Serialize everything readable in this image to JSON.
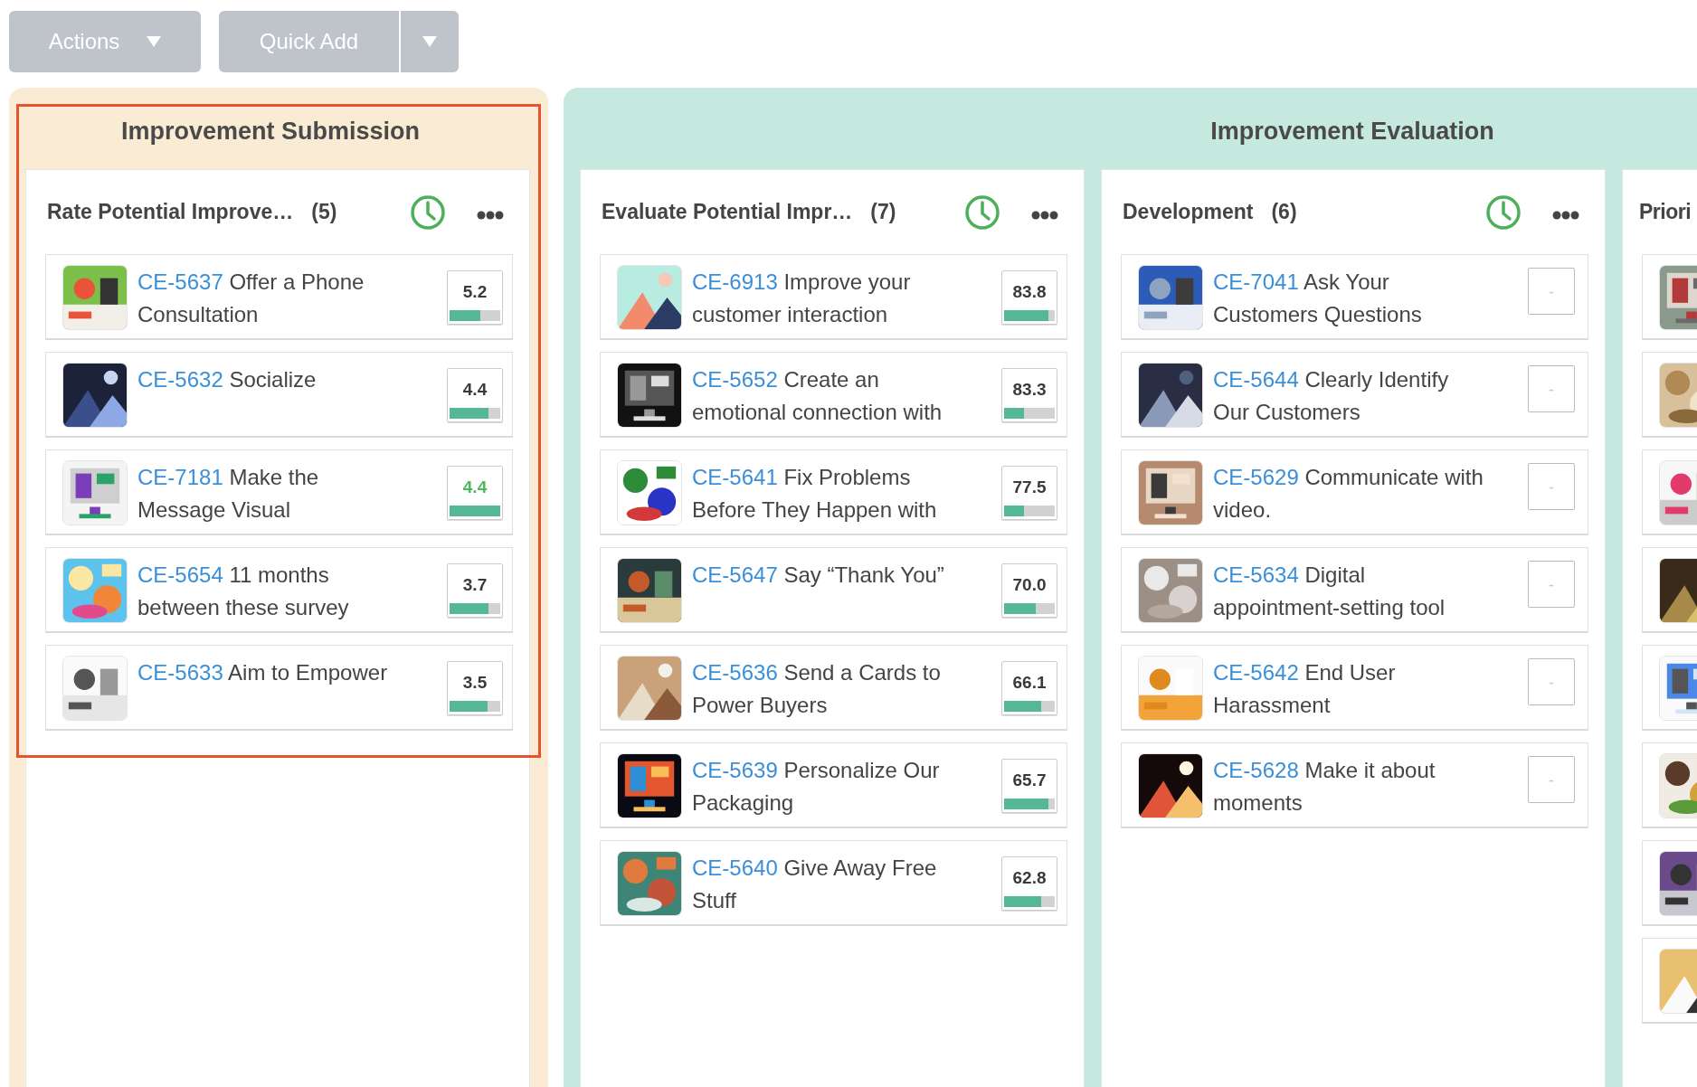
{
  "toolbar": {
    "actions_button": {
      "label": "Actions"
    },
    "quick_add_button": {
      "label": "Quick Add"
    }
  },
  "stages": [
    {
      "title": "Improvement Submission",
      "color": "#f9ebd4",
      "selected": true,
      "columns": [
        {
          "kind": "full",
          "title": "Rate Potential Improve…",
          "count": "(5)",
          "cards": [
            {
              "kind": "scored",
              "id": "CE-5637",
              "title": "Offer a Phone Consultation",
              "score": "5.2",
              "level": 0.6,
              "highlighted": false
            },
            {
              "kind": "scored",
              "id": "CE-5632",
              "title": "Socialize",
              "score": "4.4",
              "level": 0.77,
              "highlighted": false
            },
            {
              "kind": "scored",
              "id": "CE-7181",
              "title": "Make the Message Visual",
              "score": "4.4",
              "level": 1.0,
              "highlighted": true
            },
            {
              "kind": "scored",
              "id": "CE-5654",
              "title": "11 months between these survey",
              "score": "3.7",
              "level": 0.77,
              "highlighted": false
            },
            {
              "kind": "scored",
              "id": "CE-5633",
              "title": "Aim to Empower",
              "score": "3.5",
              "level": 0.75,
              "highlighted": false
            }
          ]
        }
      ]
    },
    {
      "title": "Improvement Evaluation",
      "color": "#c5e8df",
      "selected": false,
      "columns": [
        {
          "kind": "full",
          "title": "Evaluate Potential Impr…",
          "count": "(7)",
          "cards": [
            {
              "kind": "scored",
              "id": "CE-6913",
              "title": "Improve your customer interaction",
              "score": "83.8",
              "level": 0.88,
              "highlighted": false
            },
            {
              "kind": "scored",
              "id": "CE-5652",
              "title": "Create an emotional connection with",
              "score": "83.3",
              "level": 0.4,
              "highlighted": false
            },
            {
              "kind": "scored",
              "id": "CE-5641",
              "title": "Fix Problems Before They Happen with",
              "score": "77.5",
              "level": 0.4,
              "highlighted": false
            },
            {
              "kind": "scored",
              "id": "CE-5647",
              "title": "Say “Thank You”",
              "score": "70.0",
              "level": 0.62,
              "highlighted": false
            },
            {
              "kind": "scored",
              "id": "CE-5636",
              "title": "Send a Cards to Power Buyers",
              "score": "66.1",
              "level": 0.74,
              "highlighted": false
            },
            {
              "kind": "scored",
              "id": "CE-5639",
              "title": "Personalize Our Packaging",
              "score": "65.7",
              "level": 0.88,
              "highlighted": false
            },
            {
              "kind": "scored",
              "id": "CE-5640",
              "title": "Give Away Free Stuff",
              "score": "62.8",
              "level": 0.74,
              "highlighted": false
            }
          ]
        },
        {
          "kind": "full",
          "title": "Development",
          "count": "(6)",
          "cards": [
            {
              "kind": "unscored",
              "id": "CE-7041",
              "title": "Ask Your Customers Questions",
              "score": "-"
            },
            {
              "kind": "unscored",
              "id": "CE-5644",
              "title": "Clearly Identify Our Customers",
              "score": "-"
            },
            {
              "kind": "unscored",
              "id": "CE-5629",
              "title": "Communicate with video.",
              "score": "-"
            },
            {
              "kind": "unscored",
              "id": "CE-5634",
              "title": "Digital appointment-setting tool",
              "score": "-"
            },
            {
              "kind": "unscored",
              "id": "CE-5642",
              "title": "End User Harassment",
              "score": "-"
            },
            {
              "kind": "unscored",
              "id": "CE-5628",
              "title": "Make it about moments",
              "score": "-"
            }
          ]
        },
        {
          "kind": "clipped",
          "title": "Priori",
          "cards": [
            {
              "kind": "clipped"
            },
            {
              "kind": "clipped"
            },
            {
              "kind": "clipped"
            },
            {
              "kind": "clipped"
            },
            {
              "kind": "clipped"
            },
            {
              "kind": "clipped"
            },
            {
              "kind": "clipped"
            },
            {
              "kind": "clipped"
            }
          ]
        }
      ]
    }
  ]
}
